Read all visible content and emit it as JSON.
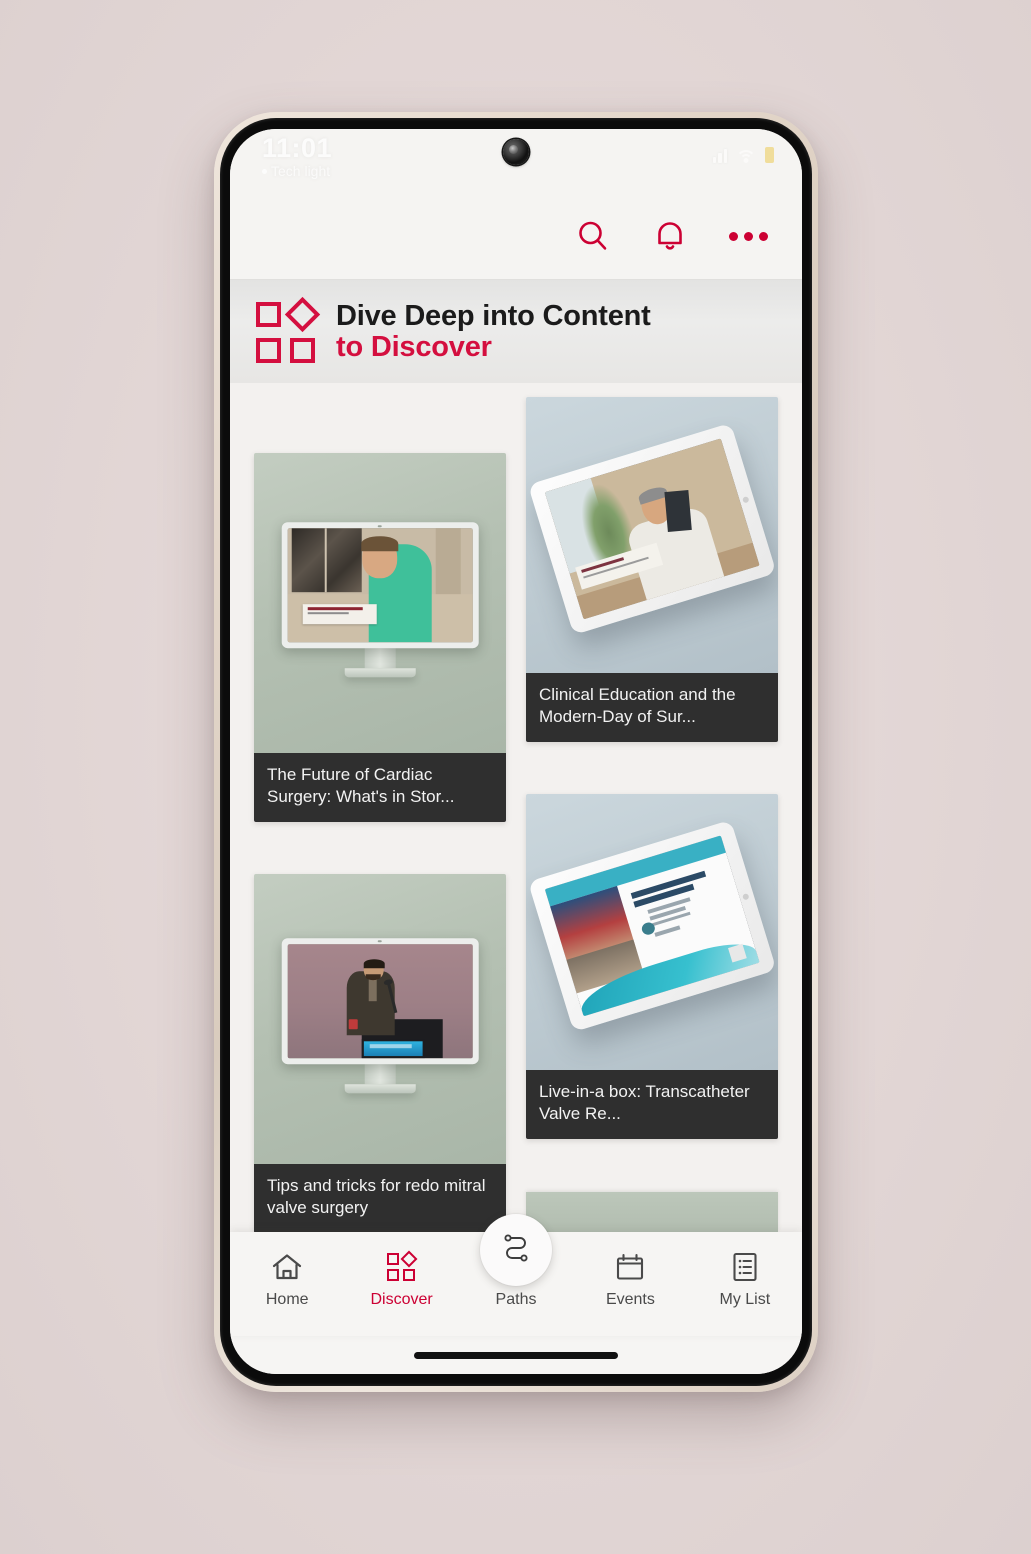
{
  "status_bar": {
    "time": "11:01",
    "carrier": "Tech light",
    "signal_icon": "cellular-signal-icon",
    "wifi_icon": "wifi-icon",
    "battery_icon": "battery-icon",
    "camera": "front-camera-icon"
  },
  "top_bar": {
    "search_icon": "search-icon",
    "notifications_icon": "bell-icon",
    "more_icon": "more-options-icon"
  },
  "banner": {
    "icon": "discover-squares-diamond-icon",
    "line1": "Dive Deep into Content",
    "line2": "to Discover",
    "accent_color": "#d40f3f"
  },
  "cards": [
    {
      "title": "The Future of Cardiac Surgery: What's in Stor...",
      "device": "desktop-monitor",
      "background": "#b4c0b2",
      "column": "left"
    },
    {
      "title": "Clinical Education and the Modern-Day of Sur...",
      "device": "tablet",
      "background": "#bfccd3",
      "column": "right"
    },
    {
      "title": "Tips and tricks for redo mitral valve surgery",
      "device": "desktop-monitor",
      "background": "#b4c0b2",
      "column": "left"
    },
    {
      "title": "Live-in-a box: Transcatheter Valve Re...",
      "device": "tablet",
      "background": "#bfccd3",
      "column": "right"
    }
  ],
  "bottom_nav": {
    "items": [
      {
        "label": "Home",
        "icon": "home-icon",
        "active": false
      },
      {
        "label": "Discover",
        "icon": "discover-squares-diamond-icon",
        "active": true
      },
      {
        "label": "Paths",
        "icon": "paths-route-icon",
        "active": false
      },
      {
        "label": "Events",
        "icon": "calendar-icon",
        "active": false
      },
      {
        "label": "My List",
        "icon": "list-document-icon",
        "active": false
      }
    ],
    "active_color": "#cc0033",
    "inactive_color": "#4a4a4a"
  }
}
